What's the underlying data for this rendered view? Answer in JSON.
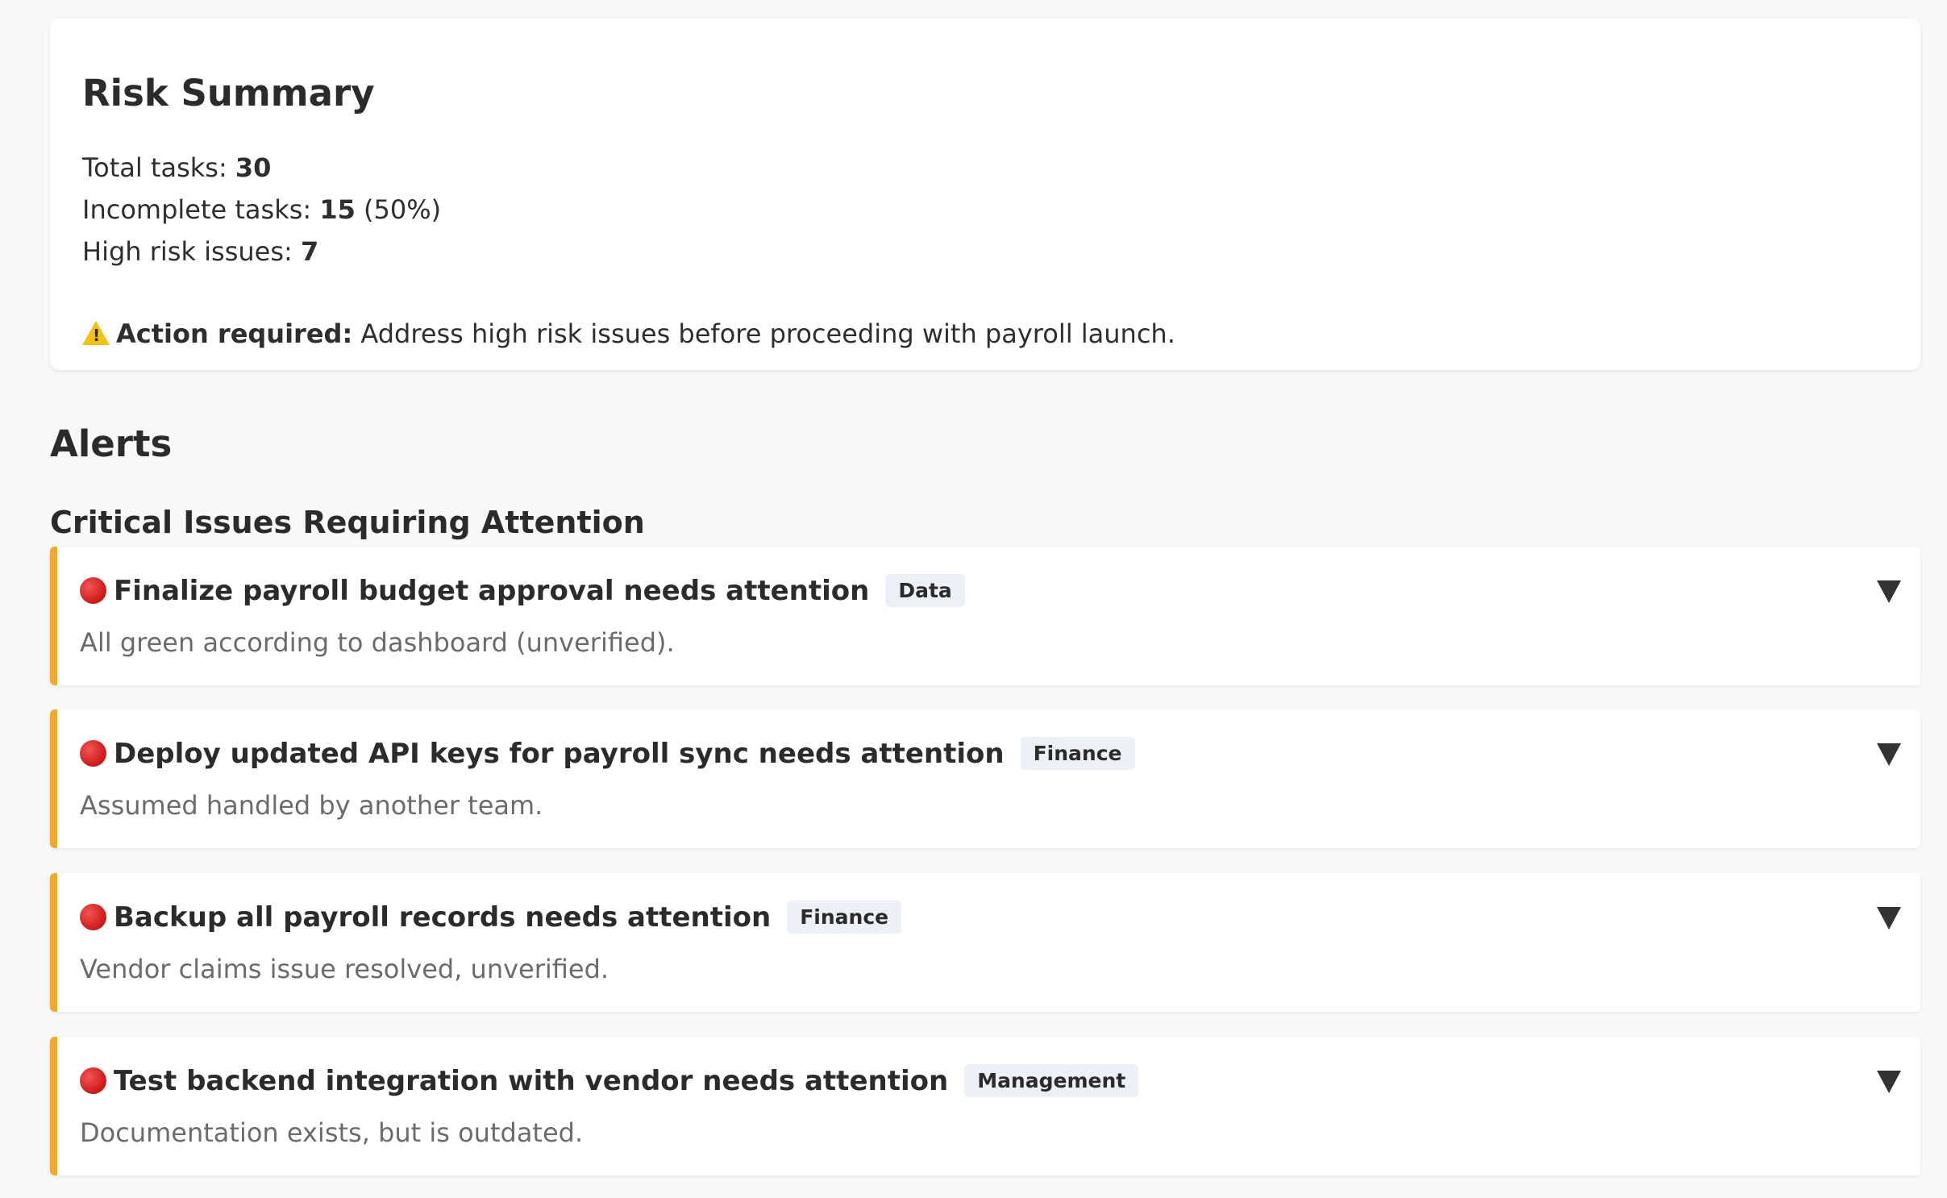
{
  "summary": {
    "title": "Risk Summary",
    "total_label": "Total tasks: ",
    "total_value": "30",
    "incomplete_label": "Incomplete tasks: ",
    "incomplete_value": "15",
    "incomplete_pct": " (50%)",
    "high_risk_label": "High risk issues: ",
    "high_risk_value": "7",
    "action_icon": "warning-icon",
    "action_label": "Action required:",
    "action_text": " Address high risk issues before proceeding with payroll launch."
  },
  "alerts": {
    "heading": "Alerts",
    "subheading": "Critical Issues Requiring Attention",
    "accent_color": "#f0a830",
    "items": [
      {
        "icon": "red-circle-icon",
        "title": "Finalize payroll budget approval needs attention",
        "tag": "Data",
        "description": "All green according to dashboard (unverified)."
      },
      {
        "icon": "red-circle-icon",
        "title": "Deploy updated API keys for payroll sync needs attention",
        "tag": "Finance",
        "description": "Assumed handled by another team."
      },
      {
        "icon": "red-circle-icon",
        "title": "Backup all payroll records needs attention",
        "tag": "Finance",
        "description": "Vendor claims issue resolved, unverified."
      },
      {
        "icon": "red-circle-icon",
        "title": "Test backend integration with vendor needs attention",
        "tag": "Management",
        "description": "Documentation exists, but is outdated."
      }
    ]
  }
}
